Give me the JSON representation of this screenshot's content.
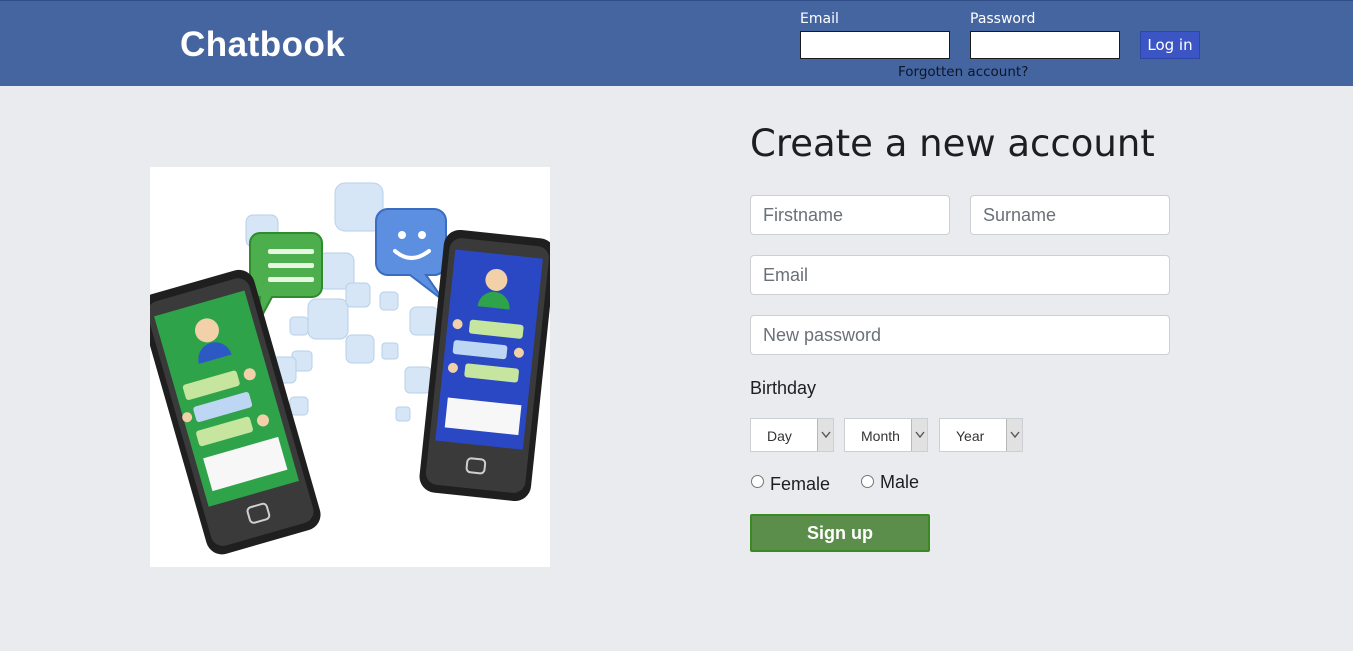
{
  "header": {
    "logo": "Chatbook",
    "email_label": "Email",
    "password_label": "Password",
    "login_label": "Log in",
    "forgot_label": "Forgotten account?"
  },
  "signup": {
    "title": "Create a new account",
    "firstname_placeholder": "Firstname",
    "surname_placeholder": "Surname",
    "email_placeholder": "Email",
    "password_placeholder": "New password",
    "birthday_label": "Birthday",
    "day_selected": "Day",
    "month_selected": "Month",
    "year_selected": "Year",
    "female_label": "Female",
    "male_label": "Male",
    "submit_label": "Sign up"
  },
  "colors": {
    "header_bg": "#4565a0",
    "login_button": "#3b56c4",
    "signup_button": "#5b8e4a",
    "page_bg": "#e9ebee"
  },
  "icons": {
    "hero": "two-smartphones-chatting-illustration",
    "select_arrow": "chevron-down-icon"
  }
}
